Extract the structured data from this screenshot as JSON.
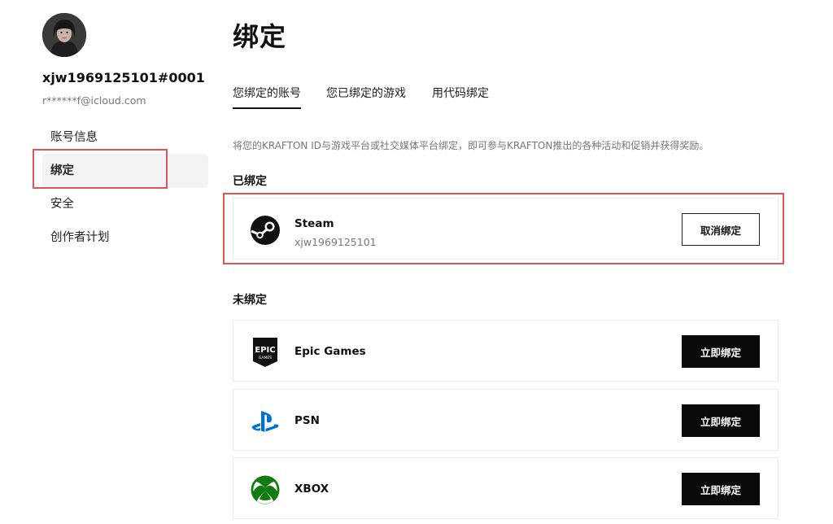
{
  "sidebar": {
    "avatar_icon": "user-avatar",
    "username": "xjw1969125101#0001",
    "email": "r******f@icloud.com",
    "items": [
      {
        "label": "账号信息"
      },
      {
        "label": "绑定"
      },
      {
        "label": "安全"
      },
      {
        "label": "创作者计划"
      }
    ]
  },
  "main": {
    "title": "绑定",
    "tabs": [
      {
        "label": "您绑定的账号"
      },
      {
        "label": "您已绑定的游戏"
      },
      {
        "label": "用代码绑定"
      }
    ],
    "description": "将您的KRAFTON ID与游戏平台或社交媒体平台绑定，即可参与KRAFTON推出的各种活动和促销并获得奖励。",
    "linked_label": "已绑定",
    "linked": [
      {
        "name": "Steam",
        "account": "xjw1969125101",
        "button": "取消绑定",
        "icon": "steam-icon"
      }
    ],
    "unlinked_label": "未绑定",
    "unlinked": [
      {
        "name": "Epic Games",
        "button": "立即绑定",
        "icon": "epic-games-icon"
      },
      {
        "name": "PSN",
        "button": "立即绑定",
        "icon": "playstation-icon",
        "color": "#0070d1"
      },
      {
        "name": "XBOX",
        "button": "立即绑定",
        "icon": "xbox-icon",
        "color": "#107c10"
      }
    ]
  },
  "colors": {
    "highlight": "#e35454",
    "active_bg": "#f3f3f5"
  }
}
